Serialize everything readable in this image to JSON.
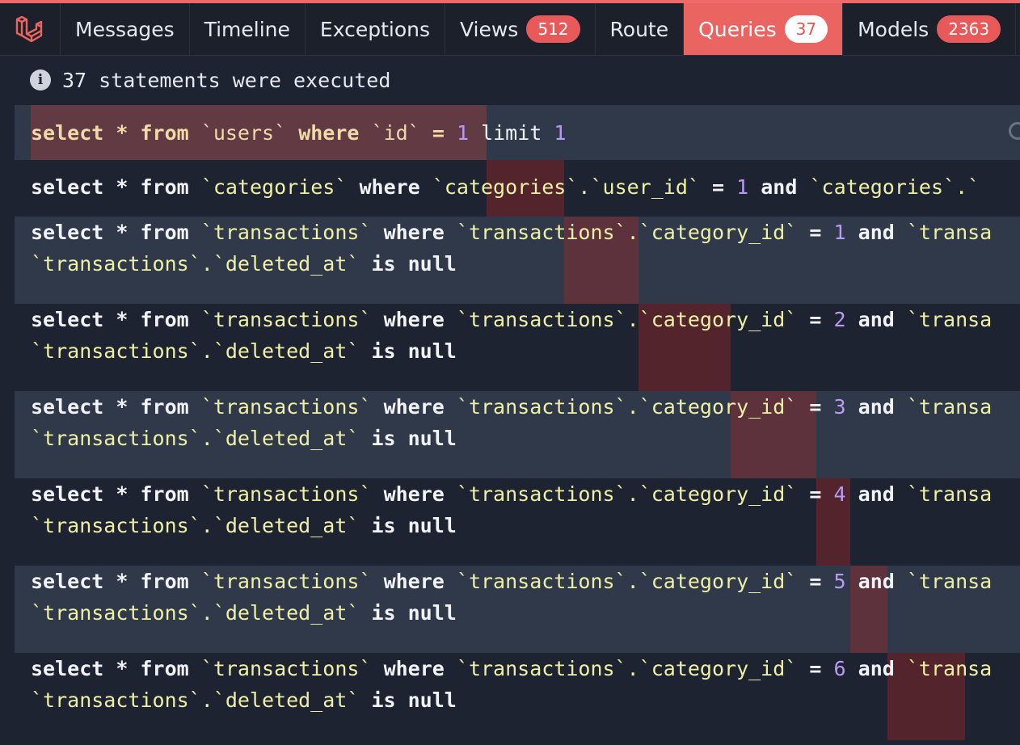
{
  "tabs": [
    {
      "label": "Messages"
    },
    {
      "label": "Timeline"
    },
    {
      "label": "Exceptions"
    },
    {
      "label": "Views",
      "badge": "512"
    },
    {
      "label": "Route"
    },
    {
      "label": "Queries",
      "badge": "37",
      "active": true
    },
    {
      "label": "Models",
      "badge": "2363"
    }
  ],
  "status": {
    "text": "37 statements were executed"
  },
  "queries": {
    "q1": {
      "select": "select",
      "star": "*",
      "from": "from",
      "table": "`users`",
      "where": "where",
      "col": "`id`",
      "eq": "=",
      "val": "1",
      "limit": "limit",
      "limit_val": "1"
    },
    "q2": {
      "select": "select",
      "star": "*",
      "from": "from",
      "table": "`categories`",
      "where": "where",
      "col": "`categories`.`user_id`",
      "eq": "=",
      "val": "1",
      "and": "and",
      "tail": "`categories`.`"
    },
    "q3": {
      "select": "select",
      "star": "*",
      "from": "from",
      "table": "`transactions`",
      "where": "where",
      "col": "`transactions`.`category_id`",
      "eq": "=",
      "val": "1",
      "and": "and",
      "tail": "`transa",
      "line2_col": "`transactions`.`deleted_at`",
      "is": "is",
      "null": "null"
    },
    "q4": {
      "select": "select",
      "star": "*",
      "from": "from",
      "table": "`transactions`",
      "where": "where",
      "col": "`transactions`.`category_id`",
      "eq": "=",
      "val": "2",
      "and": "and",
      "tail": "`transa",
      "line2_col": "`transactions`.`deleted_at`",
      "is": "is",
      "null": "null"
    },
    "q5": {
      "select": "select",
      "star": "*",
      "from": "from",
      "table": "`transactions`",
      "where": "where",
      "col": "`transactions`.`category_id`",
      "eq": "=",
      "val": "3",
      "and": "and",
      "tail": "`transa",
      "line2_col": "`transactions`.`deleted_at`",
      "is": "is",
      "null": "null"
    },
    "q6": {
      "select": "select",
      "star": "*",
      "from": "from",
      "table": "`transactions`",
      "where": "where",
      "col": "`transactions`.`category_id`",
      "eq": "=",
      "val": "4",
      "and": "and",
      "tail": "`transa",
      "line2_col": "`transactions`.`deleted_at`",
      "is": "is",
      "null": "null"
    },
    "q7": {
      "select": "select",
      "star": "*",
      "from": "from",
      "table": "`transactions`",
      "where": "where",
      "col": "`transactions`.`category_id`",
      "eq": "=",
      "val": "5",
      "and": "and",
      "tail": "`transa",
      "line2_col": "`transactions`.`deleted_at`",
      "is": "is",
      "null": "null"
    },
    "q8": {
      "select": "select",
      "star": "*",
      "from": "from",
      "table": "`transactions`",
      "where": "where",
      "col": "`transactions`.`category_id`",
      "eq": "=",
      "val": "6",
      "and": "and",
      "tail": "`transa",
      "line2_col": "`transactions`.`deleted_at`",
      "is": "is",
      "null": "null"
    }
  },
  "icons": {
    "logo": "laravel-logo-icon",
    "info": "info-icon",
    "copy": "copy-icon"
  },
  "colors": {
    "accent": "#ea6462",
    "badge": "#e85a5a",
    "identifier": "#eef0a6",
    "number": "#b79cf5",
    "row_light": "#2f3949",
    "row_dark": "#1d2330"
  }
}
